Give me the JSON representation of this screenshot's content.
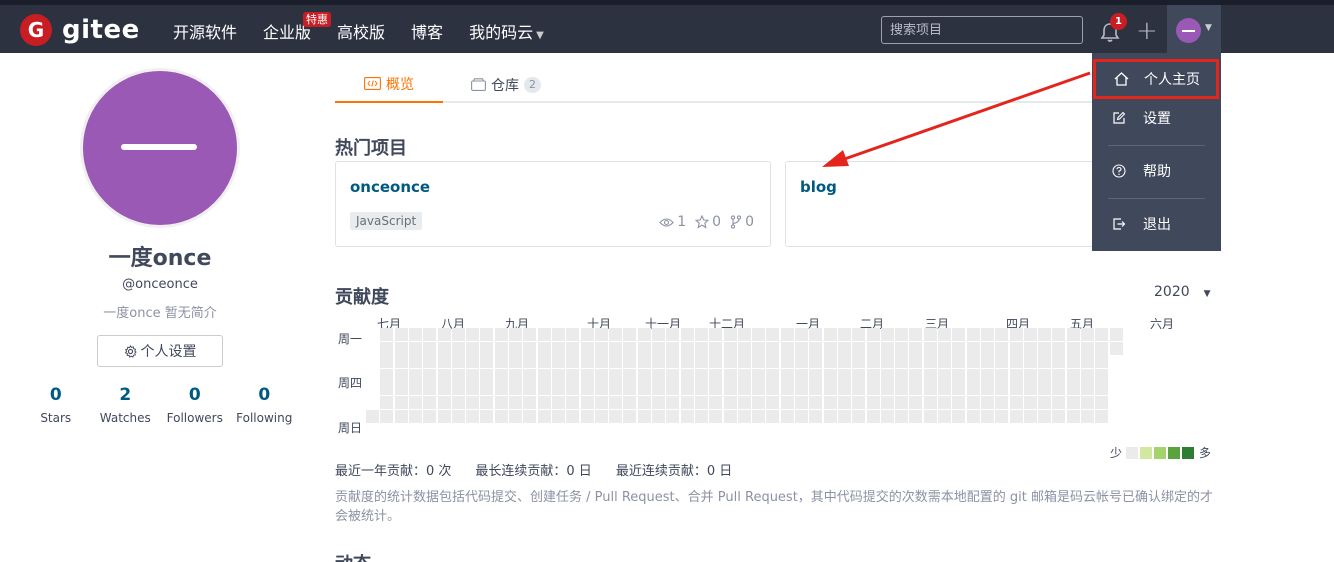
{
  "brand": {
    "logo_letter": "G",
    "name": "gitee"
  },
  "nav": {
    "items": [
      "开源软件",
      "企业版",
      "高校版",
      "博客",
      "我的码云"
    ],
    "hot_badge": "特惠",
    "search_placeholder": "搜索项目",
    "notification_count": "1",
    "plus_label": "+"
  },
  "user_menu": {
    "items": [
      "个人主页",
      "设置",
      "帮助",
      "退出"
    ]
  },
  "profile": {
    "display_name": "一度once",
    "username": "@onceonce",
    "bio": "一度once 暂无简介",
    "settings_button": "个人设置",
    "stats": [
      {
        "value": "0",
        "label": "Stars"
      },
      {
        "value": "2",
        "label": "Watches"
      },
      {
        "value": "0",
        "label": "Followers"
      },
      {
        "value": "0",
        "label": "Following"
      }
    ]
  },
  "tabs": {
    "overview": "概览",
    "repos": "仓库",
    "repos_count": "2"
  },
  "popular": {
    "title": "热门项目",
    "projects": [
      {
        "name": "onceonce",
        "language": "JavaScript",
        "watch": "1",
        "star": "0",
        "fork": "0"
      },
      {
        "name": "blog"
      }
    ]
  },
  "contribution": {
    "title": "贡献度",
    "year": "2020",
    "months": [
      "七月",
      "八月",
      "九月",
      "十月",
      "十一月",
      "十二月",
      "一月",
      "二月",
      "三月",
      "四月",
      "五月",
      "六月"
    ],
    "day_labels": [
      "周一",
      "周四",
      "周日"
    ],
    "legend_less": "少",
    "legend_more": "多",
    "legend_colors": [
      "#ebebeb",
      "#d2e8a0",
      "#a4d36c",
      "#5ba33e",
      "#2e7d32"
    ],
    "empty_color": "#ebebeb",
    "summary": [
      "最近一年贡献：0 次",
      "最长连续贡献：0 日",
      "最近连续贡献：0 日"
    ],
    "note": "贡献度的统计数据包括代码提交、创建任务 / Pull Request、合并 Pull Request，其中代码提交的次数需本地配置的 git 邮箱是码云帐号已确认绑定的才会被统计。"
  },
  "next_section_title": "动态",
  "colors": {
    "accent": "#fe7300",
    "link": "#005980",
    "brand_red": "#c71d23",
    "annotation_red": "#e4251b"
  }
}
